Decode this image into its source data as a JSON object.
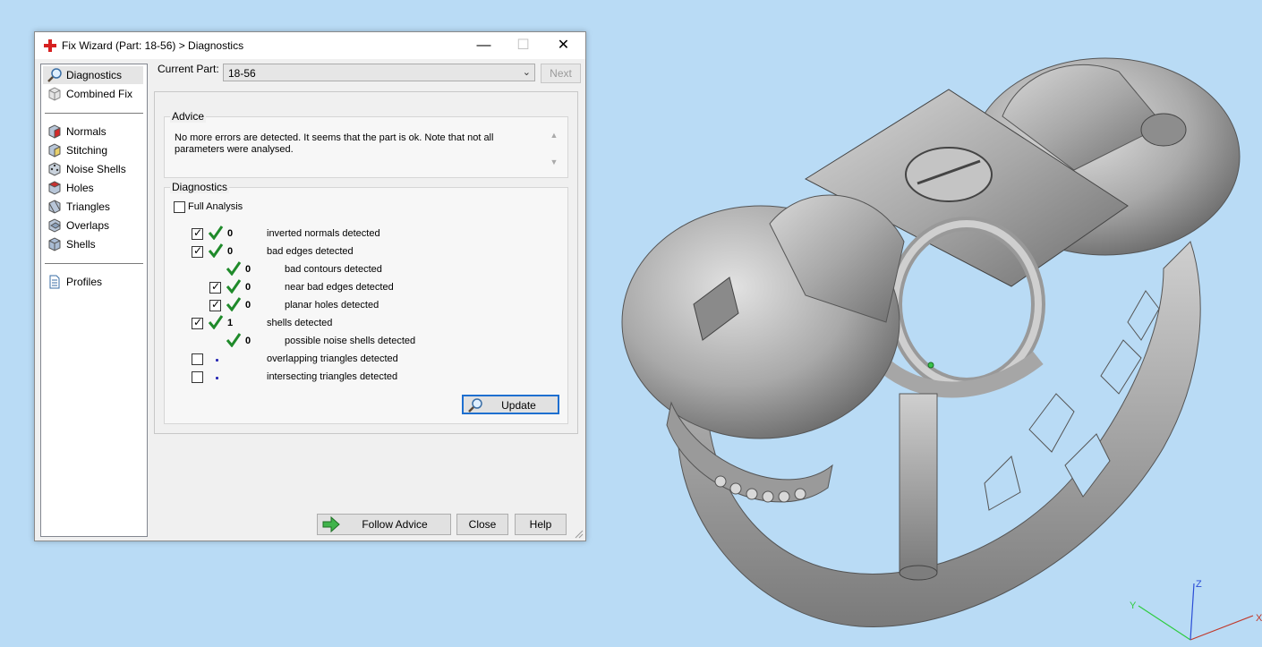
{
  "window": {
    "title": "Fix Wizard (Part: 18-56) > Diagnostics",
    "minimize_glyph": "—",
    "maximize_glyph": "☐",
    "close_glyph": "✕"
  },
  "sidebar": {
    "items": [
      {
        "label": "Diagnostics",
        "icon": "magnifier-icon",
        "selected": true
      },
      {
        "label": "Combined Fix",
        "icon": "cube-outline-icon"
      },
      {
        "label": "Normals",
        "icon": "cube-red-icon"
      },
      {
        "label": "Stitching",
        "icon": "cube-stitch-icon"
      },
      {
        "label": "Noise Shells",
        "icon": "dice-icon"
      },
      {
        "label": "Holes",
        "icon": "cube-hole-icon"
      },
      {
        "label": "Triangles",
        "icon": "cube-triangle-icon"
      },
      {
        "label": "Overlaps",
        "icon": "cube-overlap-icon"
      },
      {
        "label": "Shells",
        "icon": "cube-shell-icon"
      },
      {
        "label": "Profiles",
        "icon": "document-icon"
      }
    ]
  },
  "current_part": {
    "label": "Current Part:",
    "value": "18-56",
    "next_label": "Next"
  },
  "advice": {
    "legend": "Advice",
    "text": "No more errors are detected. It seems that the part is ok. Note that not all parameters were analysed."
  },
  "diagnostics": {
    "legend": "Diagnostics",
    "full_analysis": {
      "label": "Full Analysis",
      "checked": false
    },
    "rows": [
      {
        "label": "inverted normals detected",
        "count": "0",
        "checked": true,
        "status": "ok",
        "indent": 0
      },
      {
        "label": "bad edges detected",
        "count": "0",
        "checked": true,
        "status": "ok",
        "indent": 0
      },
      {
        "label": "bad contours detected",
        "count": "0",
        "checked": null,
        "status": "ok",
        "indent": 1
      },
      {
        "label": "near bad edges detected",
        "count": "0",
        "checked": true,
        "status": "ok",
        "indent": 1
      },
      {
        "label": "planar holes detected",
        "count": "0",
        "checked": true,
        "status": "ok",
        "indent": 1
      },
      {
        "label": "shells detected",
        "count": "1",
        "checked": true,
        "status": "ok",
        "indent": 0
      },
      {
        "label": "possible noise shells detected",
        "count": "0",
        "checked": null,
        "status": "ok",
        "indent": 1
      },
      {
        "label": "overlapping triangles detected",
        "count": "",
        "checked": false,
        "status": "unknown",
        "indent": 0
      },
      {
        "label": "intersecting triangles detected",
        "count": "",
        "checked": false,
        "status": "unknown",
        "indent": 0
      }
    ],
    "update_label": "Update"
  },
  "buttons": {
    "follow_advice": "Follow Advice",
    "close": "Close",
    "help": "Help"
  },
  "axes": {
    "x": "X",
    "y": "Y",
    "z": "Z"
  },
  "colors": {
    "viewport_bg": "#b9dbf5",
    "ok_check": "#1f8a2a",
    "accent": "#1e6fd0"
  }
}
